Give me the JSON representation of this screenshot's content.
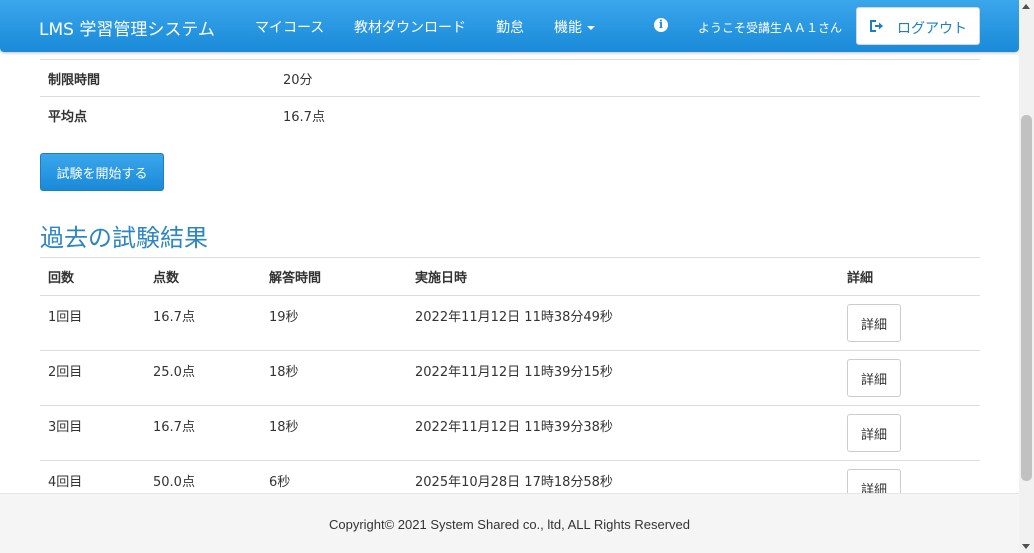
{
  "navbar": {
    "brand": "LMS 学習管理システム",
    "links": [
      "マイコース",
      "教材ダウンロード",
      "勤怠",
      "機能"
    ],
    "welcome": "ようこそ受講生ＡＡ１さん",
    "logout_label": "ログアウト",
    "info_icon": "info-icon"
  },
  "exam_info": {
    "rows": [
      {
        "label": "制限時間",
        "value": "20分"
      },
      {
        "label": "平均点",
        "value": "16.7点"
      }
    ]
  },
  "start_button_label": "試験を開始する",
  "past_results": {
    "title": "過去の試験結果",
    "headers": [
      "回数",
      "点数",
      "解答時間",
      "実施日時",
      "詳細"
    ],
    "rows": [
      {
        "count": "1回目",
        "score": "16.7点",
        "time": "19秒",
        "date": "2022年11月12日 11時38分49秒",
        "detail": "詳細"
      },
      {
        "count": "2回目",
        "score": "25.0点",
        "time": "18秒",
        "date": "2022年11月12日 11時39分15秒",
        "detail": "詳細"
      },
      {
        "count": "3回目",
        "score": "16.7点",
        "time": "18秒",
        "date": "2022年11月12日 11時39分38秒",
        "detail": "詳細"
      },
      {
        "count": "4回目",
        "score": "50.0点",
        "time": "6秒",
        "date": "2025年10月28日 17時18分58秒",
        "detail": "詳細"
      }
    ]
  },
  "footer": {
    "copyright": "Copyright© 2021 System Shared co., ltd, ALL Rights Reserved"
  },
  "colors": {
    "primary": "#1f8fdc",
    "title": "#2d86c3"
  }
}
